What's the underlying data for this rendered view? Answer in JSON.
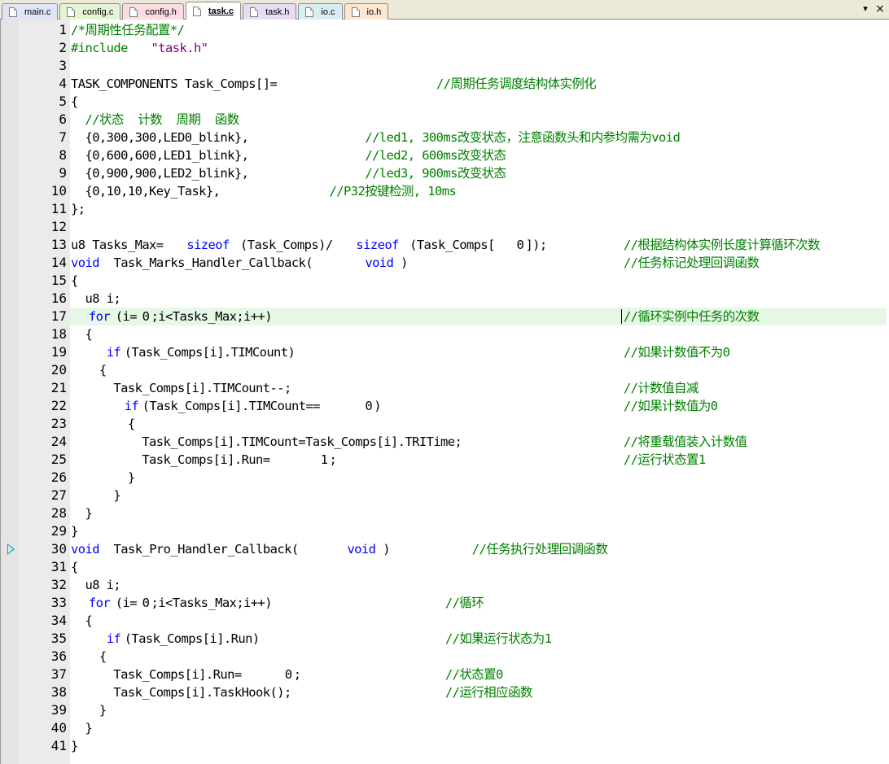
{
  "tabs": [
    {
      "label": "main.c",
      "color": "#dfe4f7",
      "active": false
    },
    {
      "label": "config.c",
      "color": "#e4f4d4",
      "active": false
    },
    {
      "label": "config.h",
      "color": "#f9dde2",
      "active": false
    },
    {
      "label": "task.c",
      "color": "#ffffff",
      "active": true
    },
    {
      "label": "task.h",
      "color": "#e8dcf4",
      "active": false
    },
    {
      "label": "io.c",
      "color": "#d8eef2",
      "active": false
    },
    {
      "label": "io.h",
      "color": "#fbe8cf",
      "active": false
    }
  ],
  "tab_controls": {
    "dropdown": "▾",
    "close": "×"
  },
  "editor": {
    "current_line": 17,
    "bookmark_line": 30,
    "lines": [
      {
        "n": "1",
        "segs": [
          {
            "t": "/*周期性任务配置*/",
            "c": "comment",
            "col": 0
          }
        ]
      },
      {
        "n": "2",
        "segs": [
          {
            "t": "#include ",
            "c": "pre",
            "col": 0
          },
          {
            "t": "\"task.h\"",
            "c": "str",
            "col": 9
          }
        ]
      },
      {
        "n": "3",
        "segs": []
      },
      {
        "n": "4",
        "segs": [
          {
            "t": "TASK_COMPONENTS Task_Comps[]=",
            "c": "code",
            "col": 0
          },
          {
            "t": "//周期任务调度结构体实例化",
            "c": "comment",
            "col": 41
          }
        ]
      },
      {
        "n": "5",
        "segs": [
          {
            "t": "{",
            "c": "code",
            "col": 0
          }
        ]
      },
      {
        "n": "6",
        "segs": [
          {
            "t": "  //状态  计数  周期  函数",
            "c": "comment",
            "col": 0
          }
        ]
      },
      {
        "n": "7",
        "segs": [
          {
            "t": "  {0,300,300,LED0_blink},",
            "c": "code",
            "col": 0
          },
          {
            "t": "//led1, 300ms改变状态，注意函数头和内参均需为void",
            "c": "comment",
            "col": 33
          }
        ]
      },
      {
        "n": "8",
        "segs": [
          {
            "t": "  {0,600,600,LED1_blink},",
            "c": "code",
            "col": 0
          },
          {
            "t": "//led2, 600ms改变状态",
            "c": "comment",
            "col": 33
          }
        ]
      },
      {
        "n": "9",
        "segs": [
          {
            "t": "  {0,900,900,LED2_blink},",
            "c": "code",
            "col": 0
          },
          {
            "t": "//led3, 900ms改变状态",
            "c": "comment",
            "col": 33
          }
        ]
      },
      {
        "n": "10",
        "segs": [
          {
            "t": "  {0,10,10,Key_Task},",
            "c": "code",
            "col": 0
          },
          {
            "t": "//P32按键检测, 10ms",
            "c": "comment",
            "col": 29
          }
        ]
      },
      {
        "n": "11",
        "segs": [
          {
            "t": "};",
            "c": "code",
            "col": 0
          }
        ]
      },
      {
        "n": "12",
        "segs": []
      },
      {
        "n": "13",
        "segs": [
          {
            "t": "u8 Tasks_Max=",
            "c": "code",
            "col": 0
          },
          {
            "t": "sizeof",
            "c": "kw",
            "col": 13
          },
          {
            "t": "(Task_Comps)/",
            "c": "code",
            "col": 19
          },
          {
            "t": "sizeof",
            "c": "kw",
            "col": 32
          },
          {
            "t": "(Task_Comps[",
            "c": "code",
            "col": 38
          },
          {
            "t": "0",
            "c": "num",
            "col": 50
          },
          {
            "t": "]);",
            "c": "code",
            "col": 51
          },
          {
            "t": "//根据结构体实例长度计算循环次数",
            "c": "comment",
            "col": 62
          }
        ]
      },
      {
        "n": "14",
        "segs": [
          {
            "t": "void",
            "c": "kw",
            "col": 0
          },
          {
            "t": " Task_Marks_Handler_Callback(",
            "c": "code",
            "col": 4
          },
          {
            "t": "void",
            "c": "kw",
            "col": 33
          },
          {
            "t": ")",
            "c": "code",
            "col": 37
          },
          {
            "t": "//任务标记处理回调函数",
            "c": "comment",
            "col": 62
          }
        ]
      },
      {
        "n": "15",
        "segs": [
          {
            "t": "{",
            "c": "code",
            "col": 0
          }
        ]
      },
      {
        "n": "16",
        "segs": [
          {
            "t": "  u8 i;",
            "c": "code",
            "col": 0
          }
        ]
      },
      {
        "n": "17",
        "segs": [
          {
            "t": "  ",
            "c": "code",
            "col": 0
          },
          {
            "t": "for",
            "c": "kw",
            "col": 2
          },
          {
            "t": "(i=",
            "c": "code",
            "col": 5
          },
          {
            "t": "0",
            "c": "num",
            "col": 8
          },
          {
            "t": ";i<Tasks_Max;i++)",
            "c": "code",
            "col": 9
          },
          {
            "t": "//循环实例中任务的次数",
            "c": "comment",
            "col": 62
          }
        ]
      },
      {
        "n": "18",
        "segs": [
          {
            "t": "  {",
            "c": "code",
            "col": 0
          }
        ]
      },
      {
        "n": "19",
        "segs": [
          {
            "t": "    ",
            "c": "code",
            "col": 0
          },
          {
            "t": "if",
            "c": "kw",
            "col": 4
          },
          {
            "t": "(Task_Comps[i].TIMCount)",
            "c": "code",
            "col": 6
          },
          {
            "t": "//如果计数值不为0",
            "c": "comment",
            "col": 62
          }
        ]
      },
      {
        "n": "20",
        "segs": [
          {
            "t": "    {",
            "c": "code",
            "col": 0
          }
        ]
      },
      {
        "n": "21",
        "segs": [
          {
            "t": "      Task_Comps[i].TIMCount--;",
            "c": "code",
            "col": 0
          },
          {
            "t": "//计数值自减",
            "c": "comment",
            "col": 62
          }
        ]
      },
      {
        "n": "22",
        "segs": [
          {
            "t": "      ",
            "c": "code",
            "col": 0
          },
          {
            "t": "if",
            "c": "kw",
            "col": 6
          },
          {
            "t": "(Task_Comps[i].TIMCount==",
            "c": "code",
            "col": 8
          },
          {
            "t": "0",
            "c": "num",
            "col": 33
          },
          {
            "t": ")",
            "c": "code",
            "col": 34
          },
          {
            "t": "//如果计数值为0",
            "c": "comment",
            "col": 62
          }
        ]
      },
      {
        "n": "23",
        "segs": [
          {
            "t": "        {",
            "c": "code",
            "col": 0
          }
        ]
      },
      {
        "n": "24",
        "segs": [
          {
            "t": "          Task_Comps[i].TIMCount=Task_Comps[i].TRITime;",
            "c": "code",
            "col": 0
          },
          {
            "t": "//将重载值装入计数值",
            "c": "comment",
            "col": 62
          }
        ]
      },
      {
        "n": "25",
        "segs": [
          {
            "t": "          Task_Comps[i].Run=",
            "c": "code",
            "col": 0
          },
          {
            "t": "1",
            "c": "num",
            "col": 28
          },
          {
            "t": ";",
            "c": "code",
            "col": 29
          },
          {
            "t": "//运行状态置1",
            "c": "comment",
            "col": 62
          }
        ]
      },
      {
        "n": "26",
        "segs": [
          {
            "t": "        }",
            "c": "code",
            "col": 0
          }
        ]
      },
      {
        "n": "27",
        "segs": [
          {
            "t": "      }",
            "c": "code",
            "col": 0
          }
        ]
      },
      {
        "n": "28",
        "segs": [
          {
            "t": "  }",
            "c": "code",
            "col": 0
          }
        ]
      },
      {
        "n": "29",
        "segs": [
          {
            "t": "}",
            "c": "code",
            "col": 0
          }
        ]
      },
      {
        "n": "30",
        "segs": [
          {
            "t": "void",
            "c": "kw",
            "col": 0
          },
          {
            "t": " Task_Pro_Handler_Callback(",
            "c": "code",
            "col": 4
          },
          {
            "t": "void",
            "c": "kw",
            "col": 31
          },
          {
            "t": ")",
            "c": "code",
            "col": 35
          },
          {
            "t": "//任务执行处理回调函数",
            "c": "comment",
            "col": 45
          }
        ]
      },
      {
        "n": "31",
        "segs": [
          {
            "t": "{",
            "c": "code",
            "col": 0
          }
        ]
      },
      {
        "n": "32",
        "segs": [
          {
            "t": "  u8 i;",
            "c": "code",
            "col": 0
          }
        ]
      },
      {
        "n": "33",
        "segs": [
          {
            "t": "  ",
            "c": "code",
            "col": 0
          },
          {
            "t": "for",
            "c": "kw",
            "col": 2
          },
          {
            "t": "(i=",
            "c": "code",
            "col": 5
          },
          {
            "t": "0",
            "c": "num",
            "col": 8
          },
          {
            "t": ";i<Tasks_Max;i++)",
            "c": "code",
            "col": 9
          },
          {
            "t": "//循环",
            "c": "comment",
            "col": 42
          }
        ]
      },
      {
        "n": "34",
        "segs": [
          {
            "t": "  {",
            "c": "code",
            "col": 0
          }
        ]
      },
      {
        "n": "35",
        "segs": [
          {
            "t": "    ",
            "c": "code",
            "col": 0
          },
          {
            "t": "if",
            "c": "kw",
            "col": 4
          },
          {
            "t": "(Task_Comps[i].Run)",
            "c": "code",
            "col": 6
          },
          {
            "t": "//如果运行状态为1",
            "c": "comment",
            "col": 42
          }
        ]
      },
      {
        "n": "36",
        "segs": [
          {
            "t": "    {",
            "c": "code",
            "col": 0
          }
        ]
      },
      {
        "n": "37",
        "segs": [
          {
            "t": "      Task_Comps[i].Run=",
            "c": "code",
            "col": 0
          },
          {
            "t": "0",
            "c": "num",
            "col": 24
          },
          {
            "t": ";",
            "c": "code",
            "col": 25
          },
          {
            "t": "//状态置0",
            "c": "comment",
            "col": 42
          }
        ]
      },
      {
        "n": "38",
        "segs": [
          {
            "t": "      Task_Comps[i].TaskHook();",
            "c": "code",
            "col": 0
          },
          {
            "t": "//运行相应函数",
            "c": "comment",
            "col": 42
          }
        ]
      },
      {
        "n": "39",
        "segs": [
          {
            "t": "    }",
            "c": "code",
            "col": 0
          }
        ]
      },
      {
        "n": "40",
        "segs": [
          {
            "t": "  }",
            "c": "code",
            "col": 0
          }
        ]
      },
      {
        "n": "41",
        "segs": [
          {
            "t": "}",
            "c": "code",
            "col": 0
          }
        ]
      }
    ]
  }
}
